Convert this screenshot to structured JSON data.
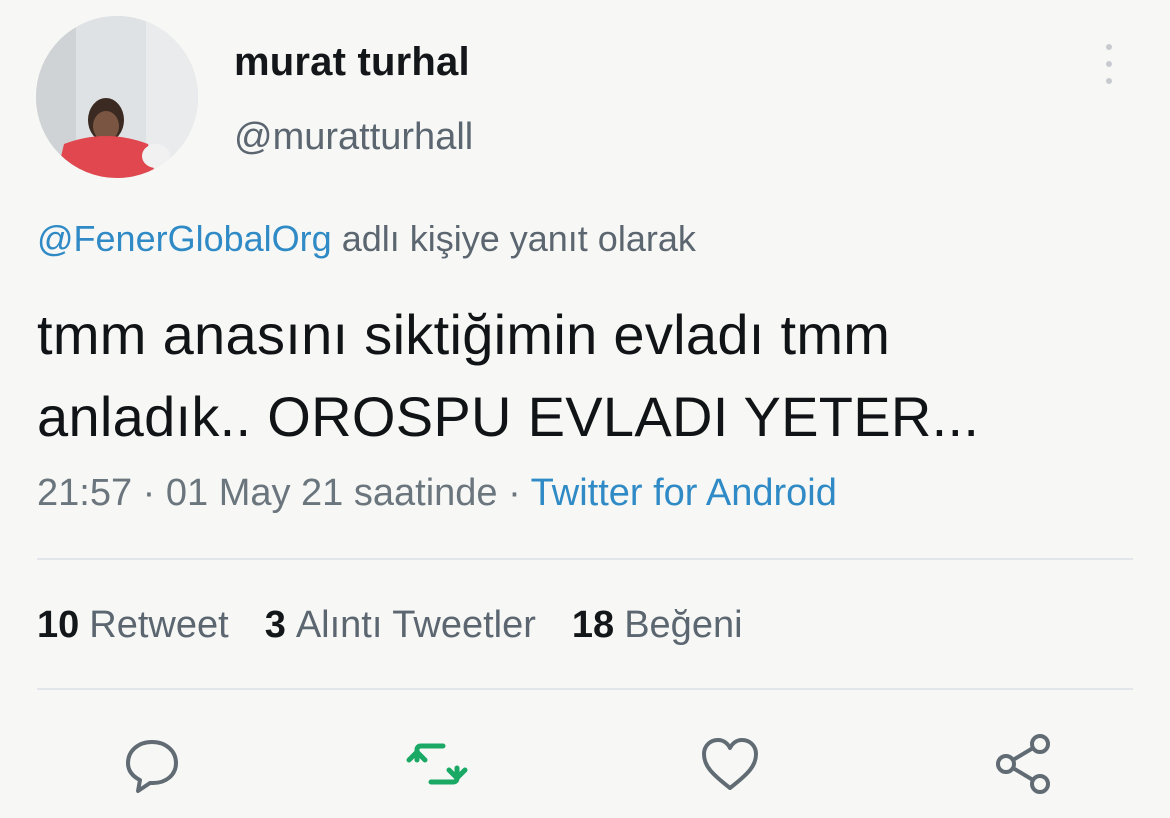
{
  "header": {
    "display_name": "murat turhal",
    "handle": "@muratturhall"
  },
  "reply": {
    "mention": "@FenerGlobalOrg",
    "suffix": "adlı kişiye yanıt olarak"
  },
  "tweet": {
    "line1": "tmm anasını siktiğimin evladı tmm",
    "line2": "anladık.. OROSPU EVLADI YETER..."
  },
  "meta": {
    "time": "21:57",
    "separator": "·",
    "date": "01 May 21 saatinde",
    "source": "Twitter for Android"
  },
  "stats": {
    "retweets_count": "10",
    "retweets_label": "Retweet",
    "quotes_count": "3",
    "quotes_label": "Alıntı Tweetler",
    "likes_count": "18",
    "likes_label": "Beğeni"
  },
  "icons": {
    "reply": "reply-icon",
    "retweet": "retweet-icon",
    "like": "heart-icon",
    "share": "share-icon",
    "more": "more-vertical-icon"
  },
  "colors": {
    "accent": "#2f8ac6",
    "retweet_active": "#1aa865",
    "secondary_text": "#5b6670"
  }
}
